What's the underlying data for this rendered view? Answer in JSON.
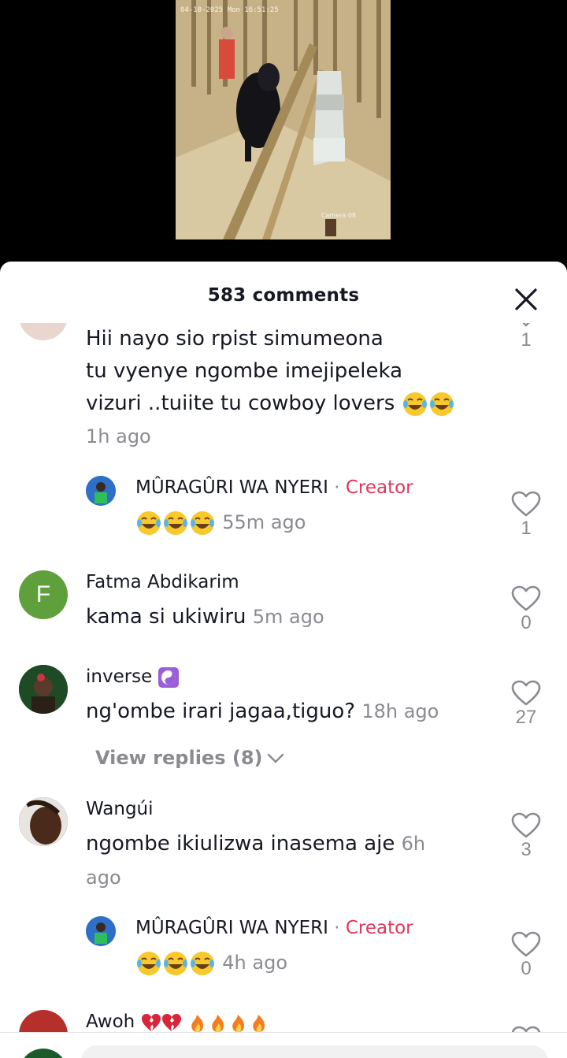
{
  "video": {
    "timestamp": "04-10-2025 Mon 16:51:25",
    "camera_label": "Camera 08"
  },
  "header": {
    "comment_count_label": "583 comments"
  },
  "comments": [
    {
      "username": "",
      "text_lines": [
        "Hii nayo sio rpist simumeona",
        "tu vyenye ngombe imejipeleka",
        "vizuri ..tuiite tu cowboy lovers"
      ],
      "time": "1h ago",
      "likes": "1"
    },
    {
      "username": "MÛRAGÛRI WA NYERI",
      "creator_sep": "·",
      "creator_label": "Creator",
      "time": "55m ago",
      "likes": "1"
    },
    {
      "avatar_letter": "F",
      "username": "Fatma Abdikarim",
      "text": "kama si ukiwiru",
      "time": "5m ago",
      "likes": "0"
    },
    {
      "username": "inverse",
      "text": "ng'ombe irari jagaa,tiguo?",
      "time": "18h ago",
      "likes": "27",
      "view_replies": "View replies (8)"
    },
    {
      "username": "Wangúi",
      "text": "ngombe ikiulizwa inasema aje",
      "time_part1": "6h",
      "time_part2": "ago",
      "likes": "3"
    },
    {
      "username": "MÛRAGÛRI WA NYERI",
      "creator_sep": "·",
      "creator_label": "Creator",
      "time": "4h ago",
      "likes": "0"
    },
    {
      "username": "Awoh"
    }
  ],
  "colors": {
    "creator": "#e0375a",
    "muted": "#8a8b91",
    "text": "#161823"
  },
  "icons": [
    "close-icon",
    "heart-icon",
    "chevron-down-icon",
    "laughing-emoji",
    "yin-yang-emoji",
    "broken-heart-emoji",
    "fire-emoji"
  ]
}
